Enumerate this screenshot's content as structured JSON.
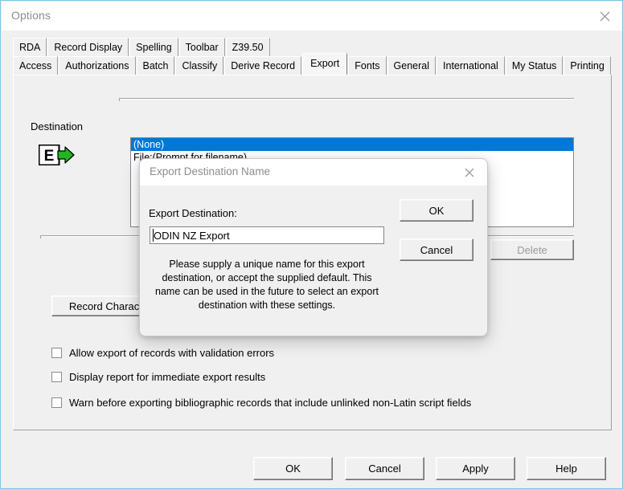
{
  "window": {
    "title": "Options",
    "close_icon": "close-icon"
  },
  "tabs": {
    "row1": [
      {
        "label": "RDA",
        "selected": false
      },
      {
        "label": "Record Display",
        "selected": false
      },
      {
        "label": "Spelling",
        "selected": false
      },
      {
        "label": "Toolbar",
        "selected": false
      },
      {
        "label": "Z39.50",
        "selected": false
      }
    ],
    "row2": [
      {
        "label": "Access",
        "selected": false
      },
      {
        "label": "Authorizations",
        "selected": false
      },
      {
        "label": "Batch",
        "selected": false
      },
      {
        "label": "Classify",
        "selected": false
      },
      {
        "label": "Derive Record",
        "selected": false
      },
      {
        "label": "Export",
        "selected": true
      },
      {
        "label": "Fonts",
        "selected": false
      },
      {
        "label": "General",
        "selected": false
      },
      {
        "label": "International",
        "selected": false
      },
      {
        "label": "My Status",
        "selected": false
      },
      {
        "label": "Printing",
        "selected": false
      }
    ]
  },
  "export_page": {
    "destination_label": "Destination",
    "destination_icon": "export-destination-icon",
    "list_items": [
      {
        "label": "(None)",
        "selected": true
      },
      {
        "label": "File:(Prompt for filename)",
        "selected": false
      }
    ],
    "delete_label": "Delete",
    "delete_disabled": true,
    "record_characteristics_label": "Record Characteristics...",
    "checkboxes": [
      {
        "label": "Allow export of records with validation errors",
        "checked": false
      },
      {
        "label": "Display report for immediate export results",
        "checked": false
      },
      {
        "label": "Warn before exporting bibliographic records that include unlinked non-Latin script fields",
        "checked": false
      }
    ]
  },
  "footer": {
    "ok_label": "OK",
    "cancel_label": "Cancel",
    "apply_label": "Apply",
    "help_label": "Help"
  },
  "modal": {
    "title": "Export Destination Name",
    "close_icon": "close-icon",
    "field_label": "Export Destination:",
    "field_value": "ODIN NZ Export",
    "field_placeholder": "",
    "help_text": "Please supply a unique name for this export destination, or accept the supplied default.  This name can be used in the future to select an export destination with these settings.",
    "ok_label": "OK",
    "cancel_label": "Cancel"
  },
  "colors": {
    "selection_blue": "#0078d7",
    "window_border": "#7fc4ea",
    "face": "#f0f0f0",
    "icon_green": "#22b422"
  }
}
